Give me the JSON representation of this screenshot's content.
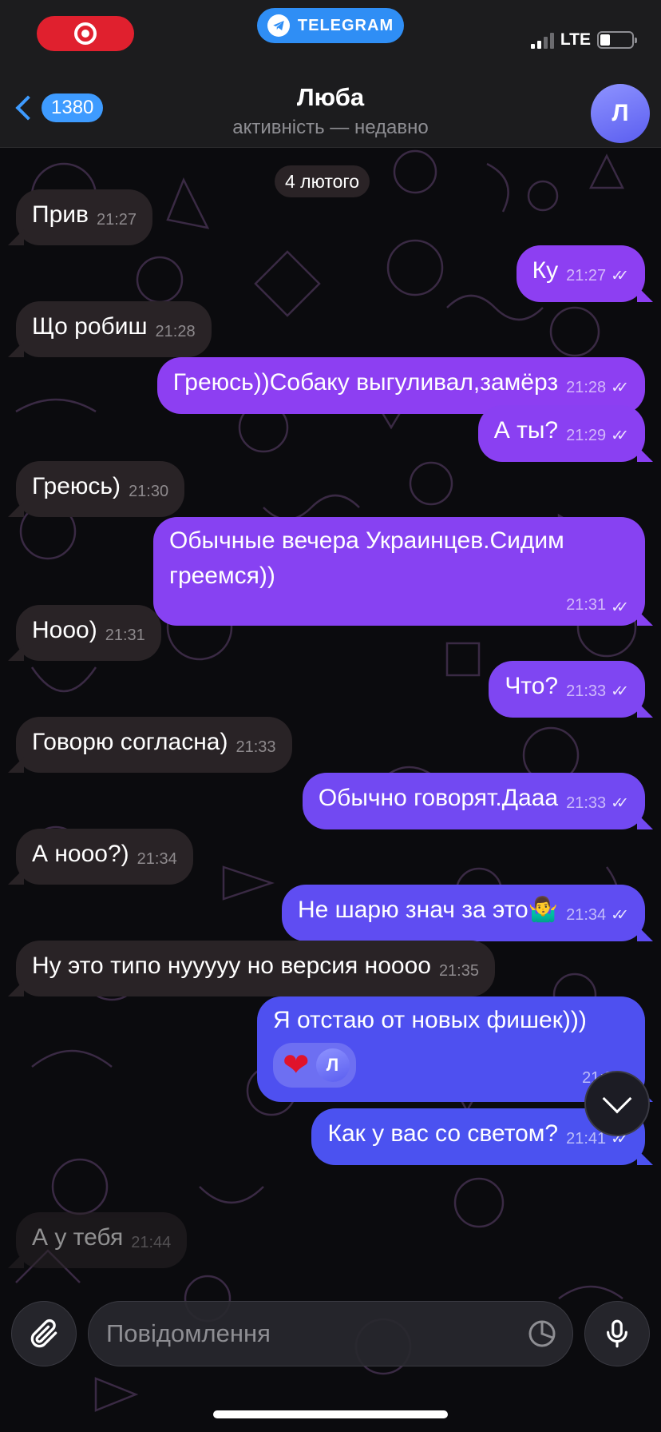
{
  "status": {
    "network": "LTE",
    "app_pill": "TELEGRAM"
  },
  "header": {
    "back_count": "1380",
    "name": "Люба",
    "subtitle": "активність — недавно",
    "avatar_letter": "Л"
  },
  "chat": {
    "date": "4 лютого",
    "messages": [
      {
        "dir": "in",
        "text": "Прив",
        "time": "21:27"
      },
      {
        "dir": "out",
        "text": "Ку",
        "time": "21:27"
      },
      {
        "dir": "in",
        "text": "Що робиш",
        "time": "21:28"
      },
      {
        "dir": "out",
        "text": "Греюсь))Собаку выгуливал,замёрз",
        "time": "21:28"
      },
      {
        "dir": "out",
        "text": "А ты?",
        "time": "21:29"
      },
      {
        "dir": "in",
        "text": "Греюсь)",
        "time": "21:30"
      },
      {
        "dir": "out",
        "text": "Обычные вечера Украинцев.Сидим греемся))",
        "time": "21:31"
      },
      {
        "dir": "in",
        "text": "Нооо)",
        "time": "21:31"
      },
      {
        "dir": "out",
        "text": "Что?",
        "time": "21:33"
      },
      {
        "dir": "in",
        "text": "Говорю согласна)",
        "time": "21:33"
      },
      {
        "dir": "out",
        "text": "Обычно говорят.Дааа",
        "time": "21:33"
      },
      {
        "dir": "in",
        "text": "А нооо?)",
        "time": "21:34"
      },
      {
        "dir": "out",
        "text": "Не шарю знач за это🤷‍♂️",
        "time": "21:34"
      },
      {
        "dir": "in",
        "text": "Ну это типо нууууу но версия ноооо",
        "time": "21:35"
      },
      {
        "dir": "out",
        "text": "Я отстаю от новых фишек)))",
        "time": "21:3",
        "reaction": {
          "emoji": "❤️",
          "avatar": "Л"
        }
      },
      {
        "dir": "out",
        "text": "Как у вас со светом?",
        "time": "21:41"
      },
      {
        "dir": "in",
        "text": "А у тебя",
        "time": "21:44"
      }
    ]
  },
  "composer": {
    "placeholder": "Повідомлення"
  },
  "colors": {
    "outgoing_top": "#9b3ff0",
    "outgoing_bottom": "#4b52f0",
    "incoming": "#292326",
    "accent": "#3e9bff"
  },
  "icons": [
    "record-icon",
    "telegram-icon",
    "signal-icon",
    "battery-icon",
    "back-chevron-icon",
    "chevron-down-icon",
    "paperclip-icon",
    "sticker-icon",
    "microphone-icon",
    "heart-icon"
  ]
}
